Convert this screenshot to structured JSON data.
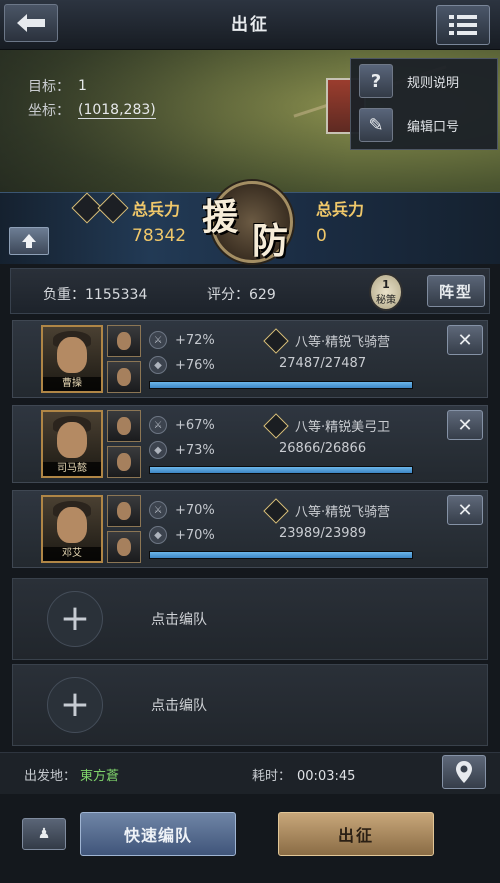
{
  "header": {
    "title": "出征"
  },
  "target": {
    "label": "目标：",
    "value": "1",
    "coord_label": "坐标：",
    "coord_value": "(1018,283)"
  },
  "menu_popup": {
    "items": [
      {
        "label": "规则说明",
        "icon": "?"
      },
      {
        "label": "编辑口号",
        "icon": "✎"
      }
    ]
  },
  "power": {
    "left_label": "总兵力",
    "left_value": "78342",
    "right_label": "总兵力",
    "right_value": "0",
    "emblem_chars": [
      "援",
      "防"
    ]
  },
  "stats": {
    "load": "负重：1155334",
    "score": "评分：629",
    "secret_num": "1",
    "secret_label": "秘策",
    "formation_label": "阵型"
  },
  "troops": [
    {
      "general": "曹操",
      "atk": "+72%",
      "def": "+76%",
      "unit": "八等·精锐飞骑营",
      "count": "27487/27487",
      "fill": 1.0
    },
    {
      "general": "司马懿",
      "atk": "+67%",
      "def": "+73%",
      "unit": "八等·精锐美弓卫",
      "count": "26866/26866",
      "fill": 1.0
    },
    {
      "general": "邓艾",
      "atk": "+70%",
      "def": "+70%",
      "unit": "八等·精锐飞骑营",
      "count": "23989/23989",
      "fill": 1.0
    }
  ],
  "empty_slots": [
    {
      "label": "点击编队"
    },
    {
      "label": "点击编队"
    }
  ],
  "depart": {
    "label": "出发地：",
    "value": "東方蒼",
    "time_label": "耗时：",
    "time_value": "00:03:45"
  },
  "actions": {
    "quick_label": "快速编队",
    "march_label": "出征"
  },
  "colors": {
    "accent_gold": "#f0c86a",
    "hp_bar": "#3d86c4",
    "origin_green": "#7fd36b"
  }
}
